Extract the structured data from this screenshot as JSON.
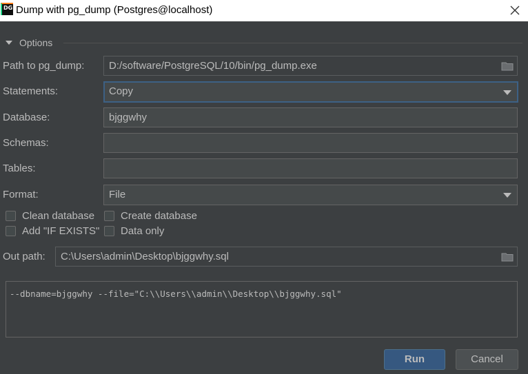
{
  "window": {
    "icon_text": "DG",
    "title": "Dump with pg_dump (Postgres@localhost)"
  },
  "options": {
    "section_label": "Options",
    "path_label": "Path to pg_dump:",
    "path_value": "D:/software/PostgreSQL/10/bin/pg_dump.exe",
    "statements_label": "Statements:",
    "statements_value": "Copy",
    "database_label": "Database:",
    "database_value": "bjggwhy",
    "schemas_label": "Schemas:",
    "schemas_value": "",
    "tables_label": "Tables:",
    "tables_value": "",
    "format_label": "Format:",
    "format_value": "File",
    "checkboxes": {
      "clean_database": "Clean database",
      "create_database": "Create database",
      "add_if_exists": "Add \"IF EXISTS\"",
      "data_only": "Data only"
    },
    "out_path_label": "Out path:",
    "out_path_value": "C:\\Users\\admin\\Desktop\\bjggwhy.sql"
  },
  "command_args": "--dbname=bjggwhy --file=\"C:\\\\Users\\\\admin\\\\Desktop\\\\bjggwhy.sql\"",
  "buttons": {
    "run": "Run",
    "cancel": "Cancel"
  },
  "colors": {
    "background": "#3c3f41",
    "field": "#45494a",
    "focus_border": "#3d6185",
    "primary_button": "#365880"
  },
  "icons": {
    "close": "close-icon",
    "folder": "folder-icon",
    "dropdown": "chevron-down-icon",
    "section": "triangle-down-icon"
  }
}
